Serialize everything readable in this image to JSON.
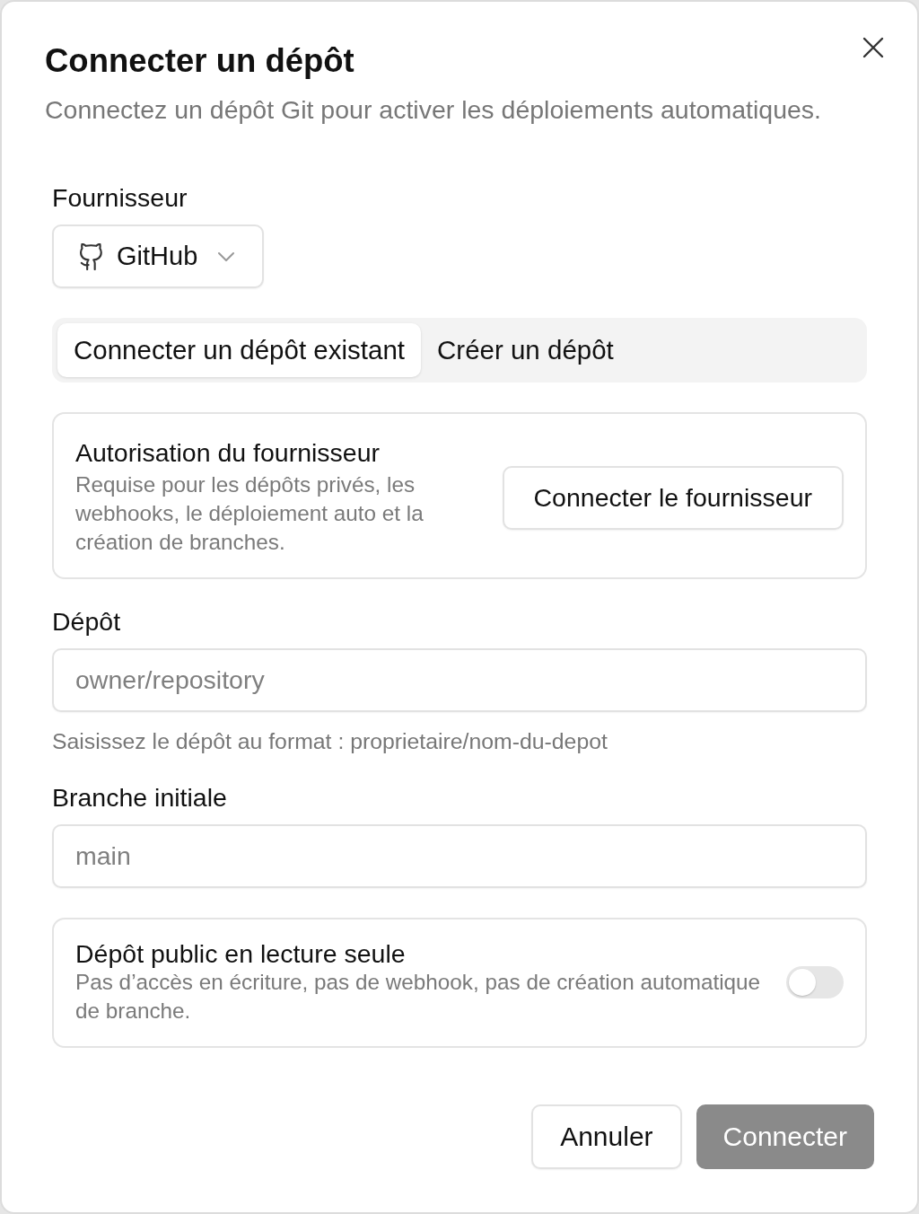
{
  "dialog": {
    "title": "Connecter un dépôt",
    "subtitle": "Connectez un dépôt Git pour activer les déploiements automatiques."
  },
  "provider": {
    "label": "Fournisseur",
    "value": "GitHub"
  },
  "tabs": [
    {
      "label": "Connecter un dépôt existant",
      "selected": true
    },
    {
      "label": "Créer un dépôt",
      "selected": false
    }
  ],
  "auth_card": {
    "title": "Autorisation du fournisseur",
    "description": "Requise pour les dépôts privés, les webhooks, le déploiement auto et la création de branches.",
    "button": "Connecter le fournisseur"
  },
  "fields": [
    {
      "label": "Dépôt",
      "placeholder": "owner/repository",
      "help": "Saisissez le dépôt au format : proprietaire/nom-du-depot"
    },
    {
      "label": "Branche initiale",
      "placeholder": "main"
    }
  ],
  "readonly_option": {
    "title": "Dépôt public en lecture seule",
    "description": "Pas d’accès en écriture, pas de webhook, pas de création automatique de branche.",
    "on": false
  },
  "buttons": [
    {
      "label": "Annuler",
      "kind": "secondary",
      "disabled": false
    },
    {
      "label": "Connecter",
      "kind": "primary",
      "disabled": true
    }
  ]
}
